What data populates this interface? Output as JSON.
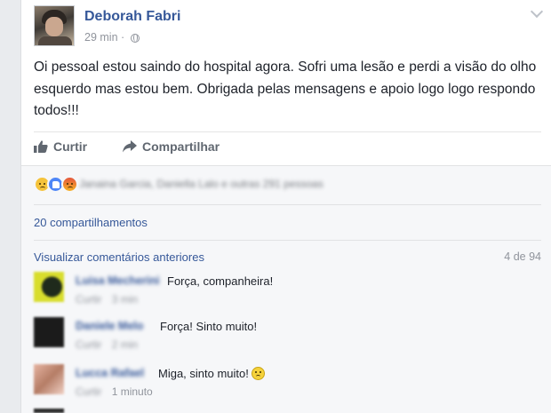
{
  "post": {
    "author": "Deborah Fabri",
    "time": "29 min",
    "dot": "·",
    "privacy_icon": "globe-icon",
    "text": "Oi pessoal estou saindo do hospital agora. Sofri uma lesão e perdi a visão do olho esquerdo mas estou bem. Obrigada pelas mensagens e apoio logo logo respondo todos!!!"
  },
  "actions": {
    "like_label": "Curtir",
    "share_label": "Compartilhar"
  },
  "reactions": {
    "icons": [
      "sad-reaction-icon",
      "like-reaction-icon",
      "angry-reaction-icon"
    ],
    "names": "Janaina Garcia, Daniella Lalo e outras 291 pessoas"
  },
  "shares": "20 compartilhamentos",
  "comments_header": {
    "view_previous": "Visualizar comentários anteriores",
    "count": "4 de 94"
  },
  "comments": [
    {
      "name": "Luisa Mecherini",
      "text": "Força, companheira!",
      "like": "Curtir",
      "time": "3 min"
    },
    {
      "name": "Daniele Melo",
      "text": "Força! Sinto muito!",
      "like": "Curtir",
      "time": "2 min"
    },
    {
      "name": "Lucca Rafael",
      "text": "Miga, sinto muito!",
      "like": "Curtir",
      "time": "1 minuto"
    }
  ],
  "colors": {
    "link": "#365899",
    "text": "#1d2129",
    "muted": "#90949c",
    "background": "#e9ebee"
  }
}
